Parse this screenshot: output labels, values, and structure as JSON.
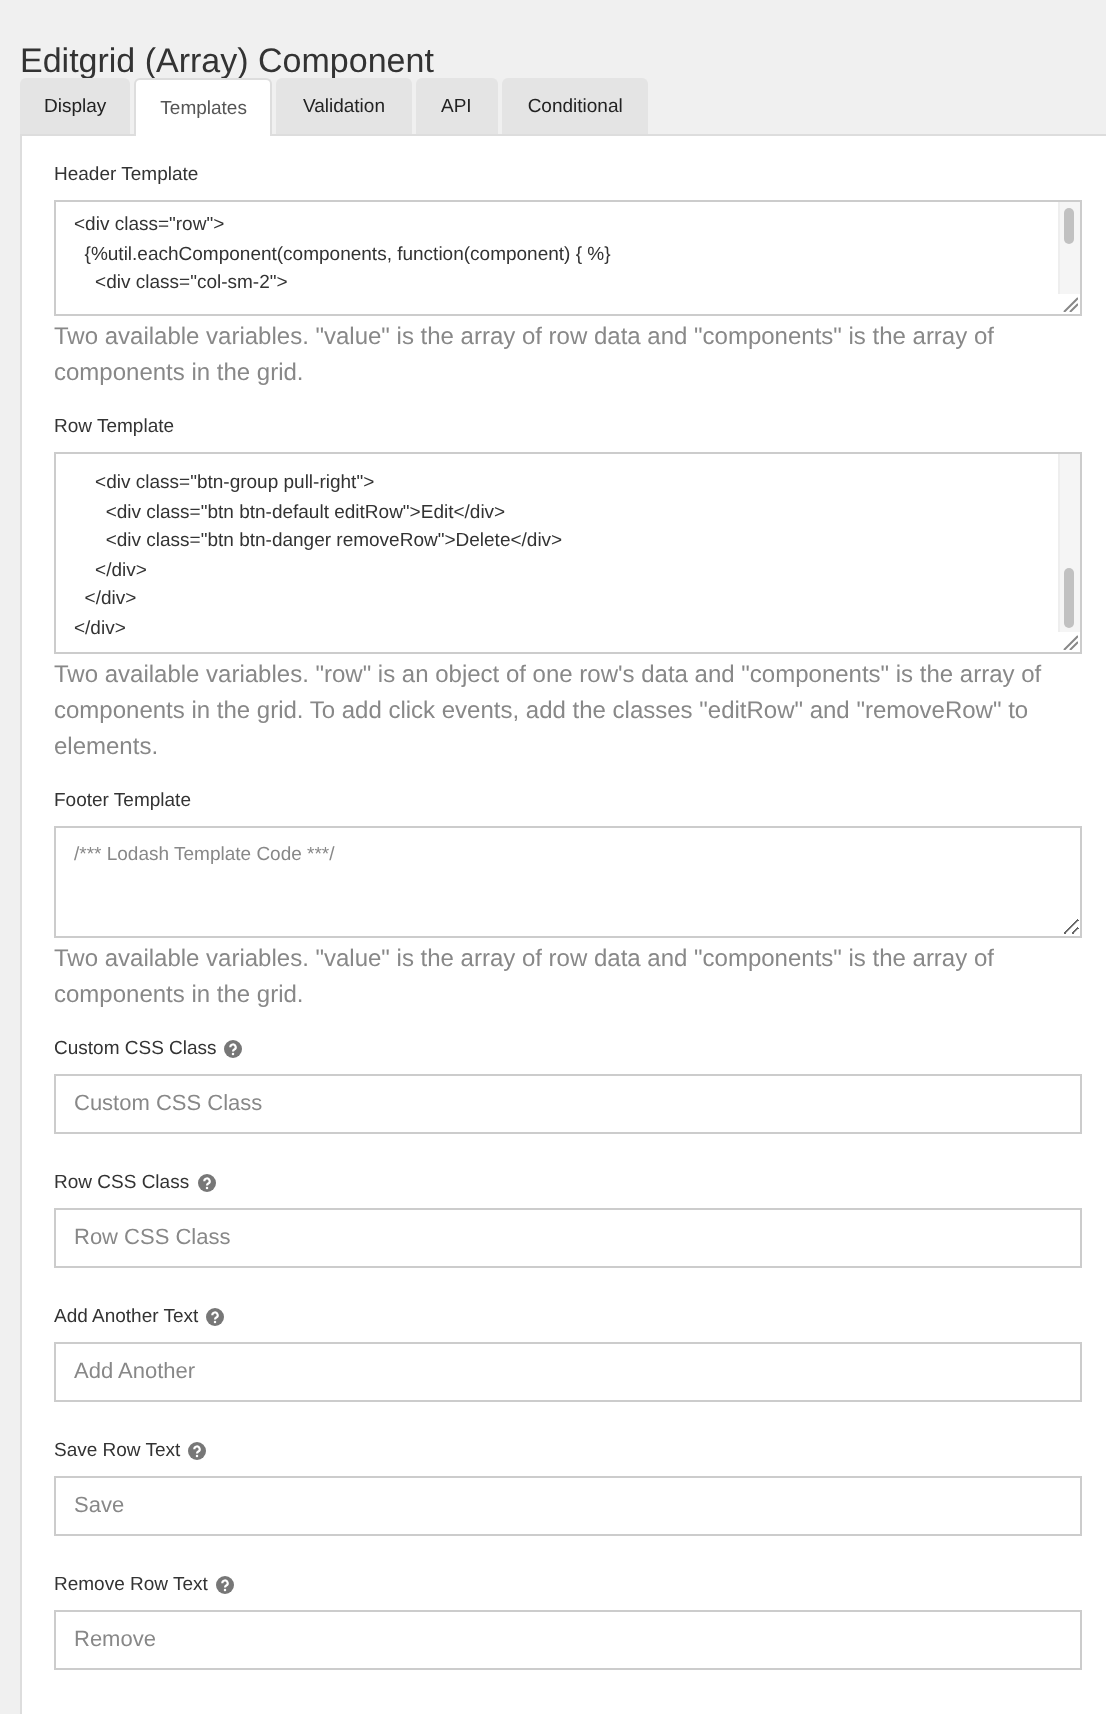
{
  "title": "Editgrid (Array) Component",
  "tabs": [
    {
      "label": "Display",
      "selected": false
    },
    {
      "label": "Templates",
      "selected": true
    },
    {
      "label": "Validation",
      "selected": false
    },
    {
      "label": "API",
      "selected": false
    },
    {
      "label": "Conditional",
      "selected": false
    }
  ],
  "sections": [
    {
      "kind": "code",
      "label": "Header Template",
      "scrolled": false,
      "lines": [
        "<div class=\"row\">",
        "  {%util.eachComponent(components, function(component) { %}",
        "    <div class=\"col-sm-2\">"
      ],
      "help": "Two available variables. \"value\" is the array of row data and \"components\" is the array of components in the grid."
    },
    {
      "kind": "code",
      "label": "Row Template",
      "scrolled": true,
      "lines": [
        "    <div class=\"btn-group pull-right\">",
        "      <div class=\"btn btn-default editRow\">Edit</div>",
        "      <div class=\"btn btn-danger removeRow\">Delete</div>",
        "    </div>",
        "  </div>",
        "</div>"
      ],
      "help": "Two available variables. \"row\" is an object of one row's data and \"components\" is the array of components in the grid. To add click events, add the classes \"editRow\" and \"removeRow\" to elements."
    },
    {
      "kind": "textarea",
      "label": "Footer Template",
      "placeholder": "/*** Lodash Template Code ***/",
      "help": "Two available variables. \"value\" is the array of row data and \"components\" is the array of components in the grid."
    },
    {
      "kind": "input",
      "label": "Custom CSS Class",
      "placeholder": "Custom CSS Class"
    },
    {
      "kind": "input",
      "label": "Row CSS Class",
      "placeholder": "Row CSS Class"
    },
    {
      "kind": "input",
      "label": "Add Another Text",
      "placeholder": "Add Another"
    },
    {
      "kind": "input",
      "label": "Save Row Text",
      "placeholder": "Save"
    },
    {
      "kind": "input",
      "label": "Remove Row Text",
      "placeholder": "Remove"
    }
  ]
}
